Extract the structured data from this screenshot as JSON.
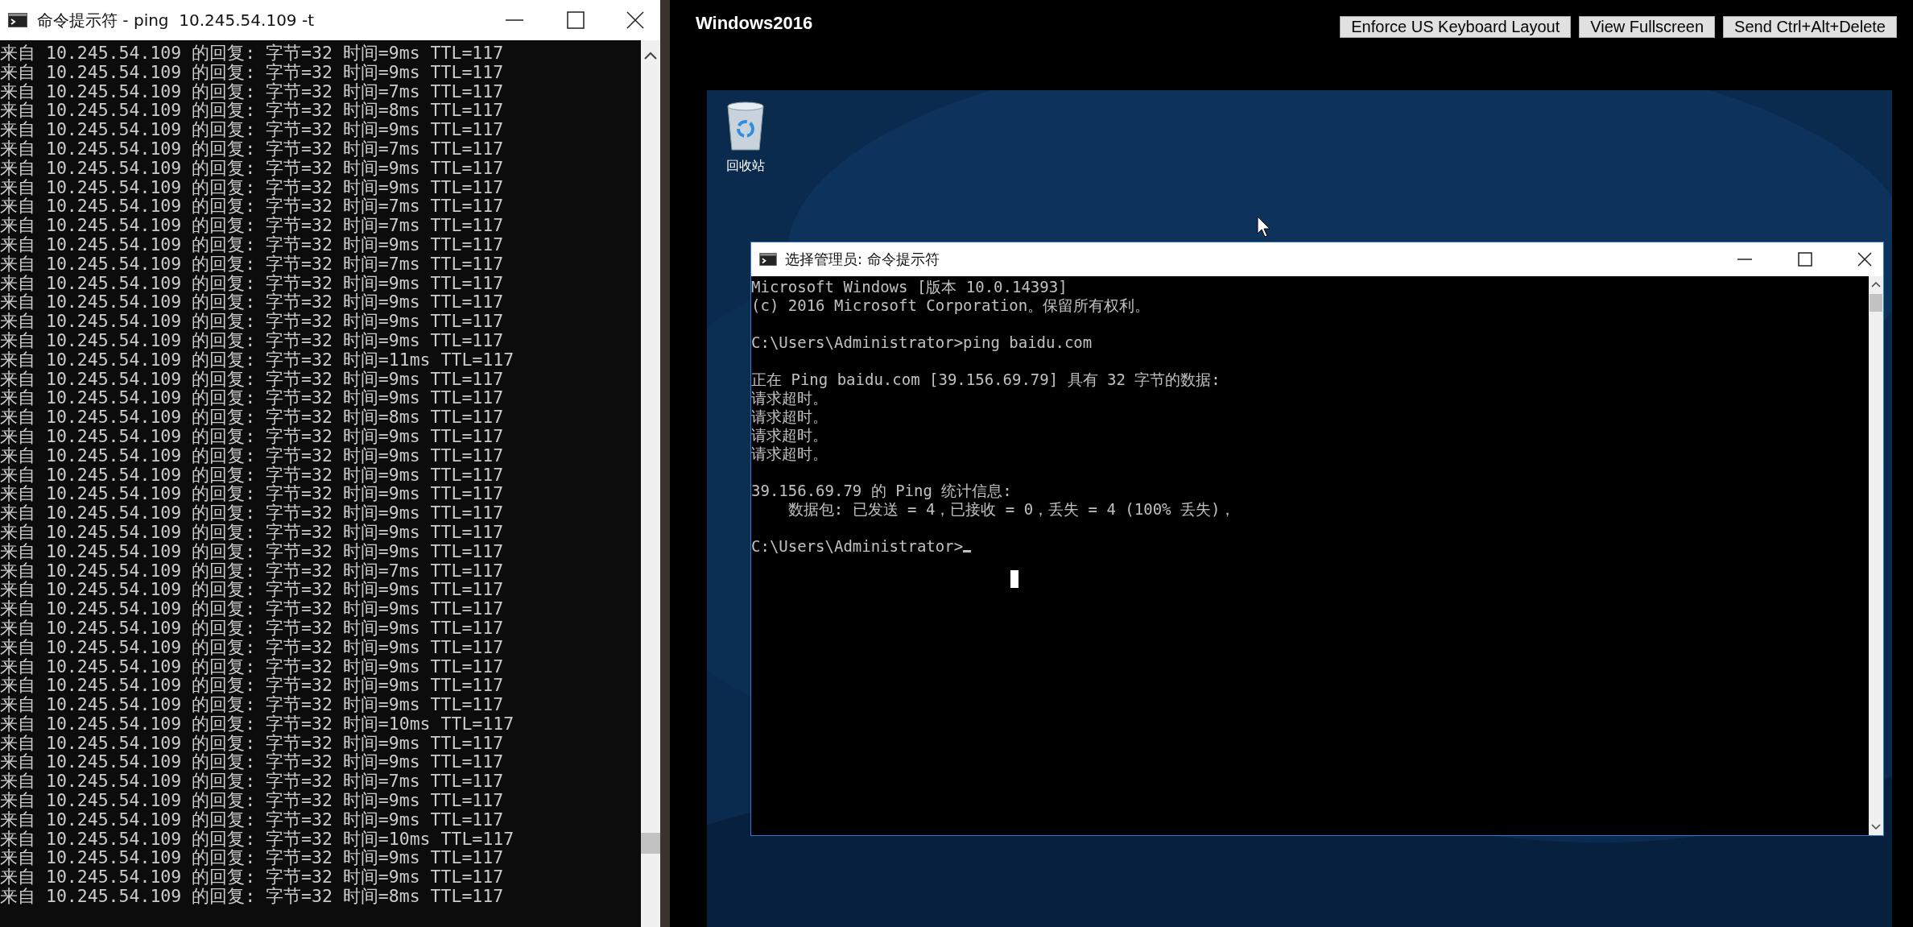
{
  "left_window": {
    "title": "命令提示符 - ping  10.245.54.109 -t",
    "lines": [
      "来自 10.245.54.109 的回复: 字节=32 时间=9ms TTL=117",
      "来自 10.245.54.109 的回复: 字节=32 时间=9ms TTL=117",
      "来自 10.245.54.109 的回复: 字节=32 时间=7ms TTL=117",
      "来自 10.245.54.109 的回复: 字节=32 时间=8ms TTL=117",
      "来自 10.245.54.109 的回复: 字节=32 时间=9ms TTL=117",
      "来自 10.245.54.109 的回复: 字节=32 时间=7ms TTL=117",
      "来自 10.245.54.109 的回复: 字节=32 时间=9ms TTL=117",
      "来自 10.245.54.109 的回复: 字节=32 时间=9ms TTL=117",
      "来自 10.245.54.109 的回复: 字节=32 时间=7ms TTL=117",
      "来自 10.245.54.109 的回复: 字节=32 时间=7ms TTL=117",
      "来自 10.245.54.109 的回复: 字节=32 时间=9ms TTL=117",
      "来自 10.245.54.109 的回复: 字节=32 时间=7ms TTL=117",
      "来自 10.245.54.109 的回复: 字节=32 时间=9ms TTL=117",
      "来自 10.245.54.109 的回复: 字节=32 时间=9ms TTL=117",
      "来自 10.245.54.109 的回复: 字节=32 时间=9ms TTL=117",
      "来自 10.245.54.109 的回复: 字节=32 时间=9ms TTL=117",
      "来自 10.245.54.109 的回复: 字节=32 时间=11ms TTL=117",
      "来自 10.245.54.109 的回复: 字节=32 时间=9ms TTL=117",
      "来自 10.245.54.109 的回复: 字节=32 时间=9ms TTL=117",
      "来自 10.245.54.109 的回复: 字节=32 时间=8ms TTL=117",
      "来自 10.245.54.109 的回复: 字节=32 时间=9ms TTL=117",
      "来自 10.245.54.109 的回复: 字节=32 时间=9ms TTL=117",
      "来自 10.245.54.109 的回复: 字节=32 时间=9ms TTL=117",
      "来自 10.245.54.109 的回复: 字节=32 时间=9ms TTL=117",
      "来自 10.245.54.109 的回复: 字节=32 时间=9ms TTL=117",
      "来自 10.245.54.109 的回复: 字节=32 时间=9ms TTL=117",
      "来自 10.245.54.109 的回复: 字节=32 时间=9ms TTL=117",
      "来自 10.245.54.109 的回复: 字节=32 时间=7ms TTL=117",
      "来自 10.245.54.109 的回复: 字节=32 时间=9ms TTL=117",
      "来自 10.245.54.109 的回复: 字节=32 时间=9ms TTL=117",
      "来自 10.245.54.109 的回复: 字节=32 时间=9ms TTL=117",
      "来自 10.245.54.109 的回复: 字节=32 时间=9ms TTL=117",
      "来自 10.245.54.109 的回复: 字节=32 时间=9ms TTL=117",
      "来自 10.245.54.109 的回复: 字节=32 时间=9ms TTL=117",
      "来自 10.245.54.109 的回复: 字节=32 时间=9ms TTL=117",
      "来自 10.245.54.109 的回复: 字节=32 时间=10ms TTL=117",
      "来自 10.245.54.109 的回复: 字节=32 时间=9ms TTL=117",
      "来自 10.245.54.109 的回复: 字节=32 时间=9ms TTL=117",
      "来自 10.245.54.109 的回复: 字节=32 时间=7ms TTL=117",
      "来自 10.245.54.109 的回复: 字节=32 时间=9ms TTL=117",
      "来自 10.245.54.109 的回复: 字节=32 时间=9ms TTL=117",
      "来自 10.245.54.109 的回复: 字节=32 时间=10ms TTL=117",
      "来自 10.245.54.109 的回复: 字节=32 时间=9ms TTL=117",
      "来自 10.245.54.109 的回复: 字节=32 时间=9ms TTL=117",
      "来自 10.245.54.109 的回复: 字节=32 时间=8ms TTL=117"
    ]
  },
  "remote": {
    "title": "Windows2016",
    "buttons": [
      "Enforce US Keyboard Layout",
      "View Fullscreen",
      "Send Ctrl+Alt+Delete"
    ],
    "desktop_icons": [
      {
        "label": "回收站"
      }
    ],
    "cmd_window": {
      "title": "选择管理员: 命令提示符",
      "blocks": [
        [
          "Microsoft Windows [版本 10.0.14393]",
          "(c) 2016 Microsoft Corporation。保留所有权利。"
        ],
        [
          "C:\\Users\\Administrator>ping baidu.com"
        ],
        [
          "正在 Ping baidu.com [39.156.69.79] 具有 32 字节的数据:",
          "请求超时。",
          "请求超时。",
          "请求超时。",
          "请求超时。"
        ],
        [
          "39.156.69.79 的 Ping 统计信息:",
          "    数据包: 已发送 = 4，已接收 = 0，丢失 = 4 (100% 丢失)，"
        ],
        [
          "C:\\Users\\Administrator>"
        ]
      ]
    }
  }
}
